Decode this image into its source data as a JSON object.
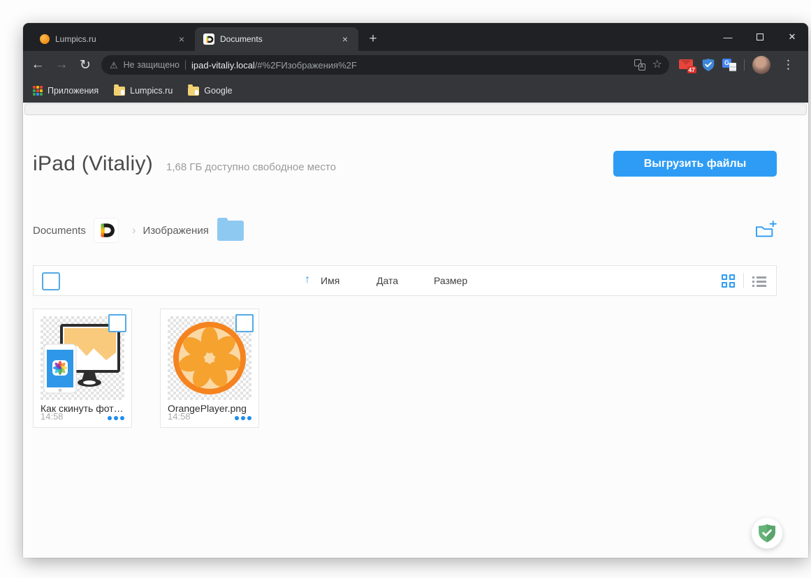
{
  "window": {
    "controls": {
      "minimize": "—",
      "close": "✕"
    }
  },
  "browser": {
    "tabs": [
      {
        "title": "Lumpics.ru",
        "close": "×",
        "active": false
      },
      {
        "title": "Documents",
        "close": "×",
        "active": true
      }
    ],
    "newtab": "+",
    "nav": {
      "back": "←",
      "forward": "→",
      "reload": "↻"
    },
    "address": {
      "warning": "⚠",
      "security_label": "Не защищено",
      "host": "ipad-vitaliy.local",
      "path": "/#%2FИзображения%2F",
      "star": "☆"
    },
    "extensions": {
      "mail_badge": "47"
    },
    "menu_dots": "⋮",
    "bookmarks": [
      {
        "label": "Приложения"
      },
      {
        "label": "Lumpics.ru"
      },
      {
        "label": "Google"
      }
    ]
  },
  "page": {
    "title": "iPad (Vitaliy)",
    "subtitle": "1,68 ГБ доступно свободное место",
    "upload_button": "Выгрузить файлы",
    "breadcrumb": {
      "root": "Documents",
      "chevron": "›",
      "current": "Изображения"
    },
    "list_header": {
      "sort_arrow": "↑",
      "columns": [
        "Имя",
        "Дата",
        "Размер"
      ]
    },
    "files": [
      {
        "name": "Как скинуть фот…",
        "time": "14:58",
        "thumb": "photo-transfer-illustration"
      },
      {
        "name": "OrangePlayer.png",
        "time": "14:58",
        "thumb": "orange-slice-logo"
      }
    ]
  },
  "colors": {
    "accent": "#2e9cf4",
    "titlebar": "#202124",
    "toolbar": "#35363a",
    "adguard_green": "#67b37a",
    "orange_logo": "#f5831f"
  }
}
